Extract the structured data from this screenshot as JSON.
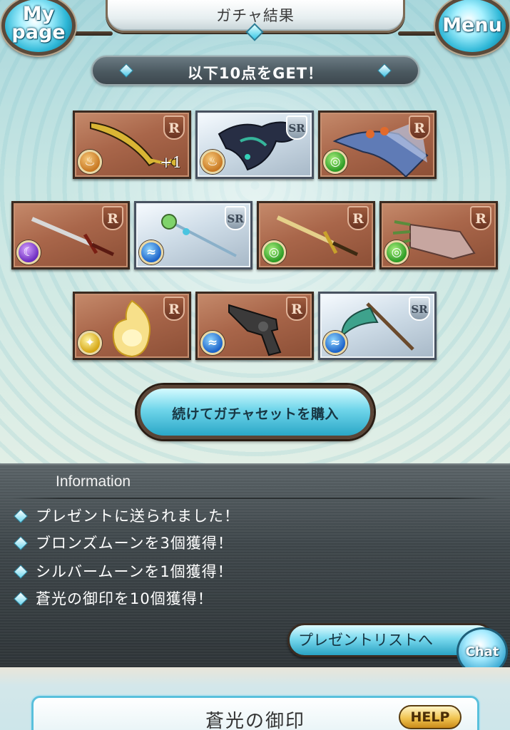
{
  "header": {
    "title": "ガチャ結果",
    "mypage_label_top": "My",
    "mypage_label_bottom": "page",
    "menu_label": "Menu"
  },
  "banner": {
    "text": "以下10点をGET！"
  },
  "cards": [
    {
      "rarity": "R",
      "element": "fire-element-icon",
      "item": "golden-scimitar",
      "plus": "+1"
    },
    {
      "rarity": "SR",
      "element": "fire-element-icon",
      "item": "dark-dragon"
    },
    {
      "rarity": "R",
      "element": "wind-element-icon",
      "item": "winged-beast"
    },
    {
      "rarity": "R",
      "element": "dark-element-icon",
      "item": "longsword"
    },
    {
      "rarity": "SR",
      "element": "water-element-icon",
      "item": "jeweled-staff"
    },
    {
      "rarity": "R",
      "element": "wind-element-icon",
      "item": "golden-sword"
    },
    {
      "rarity": "R",
      "element": "wind-element-icon",
      "item": "claw-gauntlet"
    },
    {
      "rarity": "R",
      "element": "light-element-icon",
      "item": "flame-spirit"
    },
    {
      "rarity": "R",
      "element": "water-element-icon",
      "item": "revolver"
    },
    {
      "rarity": "SR",
      "element": "water-element-icon",
      "item": "scythe"
    }
  ],
  "buy_button": {
    "label": "続けてガチャセットを購入"
  },
  "information": {
    "title": "Information",
    "lines": [
      "プレゼントに送られました！",
      "ブロンズムーンを3個獲得！",
      "シルバームーンを1個獲得！",
      "蒼光の御印を10個獲得！"
    ],
    "present_button": "プレゼントリストへ"
  },
  "chat_button": {
    "label": "Chat"
  },
  "bottom_panel": {
    "title": "蒼光の御印",
    "help_label": "HELP"
  },
  "colors": {
    "water": "#1b62c9",
    "fire": "#c77722",
    "wind": "#2d9b25",
    "dark": "#6c2bbf",
    "light": "#d5a615",
    "accent": "#2aa7c7"
  }
}
